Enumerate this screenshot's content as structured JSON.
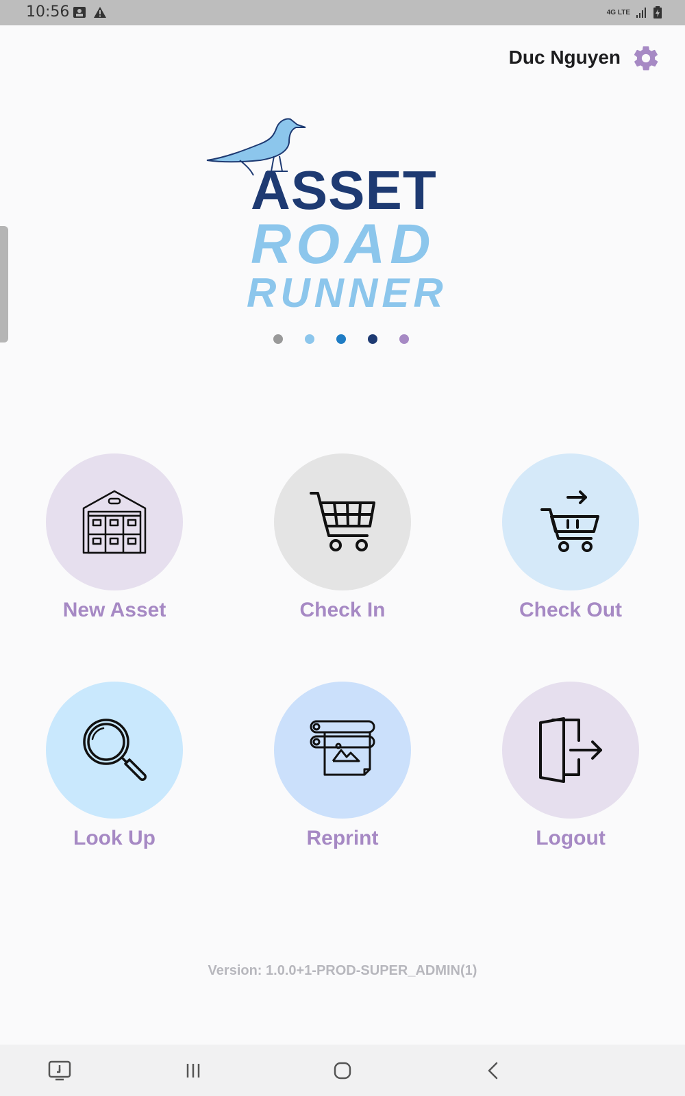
{
  "status": {
    "time": "10:56",
    "network": "4G LTE"
  },
  "header": {
    "user_name": "Duc Nguyen",
    "settings_icon": "gear-icon"
  },
  "logo": {
    "line1": "ASSET",
    "line2": "ROAD",
    "line3": "RUNNER"
  },
  "carousel_dots": [
    "#999999",
    "#8cc6ec",
    "#1f7cc4",
    "#1e3a72",
    "#a689c4"
  ],
  "actions": [
    {
      "label": "New Asset",
      "icon": "warehouse-icon",
      "bg": "#e6dfee"
    },
    {
      "label": "Check In",
      "icon": "cart-icon",
      "bg": "#e4e4e4"
    },
    {
      "label": "Check Out",
      "icon": "cart-arrow-icon",
      "bg": "#d5e9f9"
    },
    {
      "label": "Look Up",
      "icon": "magnifier-icon",
      "bg": "#c9e8fd"
    },
    {
      "label": "Reprint",
      "icon": "printer-icon",
      "bg": "#cbe0fb"
    },
    {
      "label": "Logout",
      "icon": "logout-door-icon",
      "bg": "#e6dfee"
    }
  ],
  "version": "Version: 1.0.0+1-PROD-SUPER_ADMIN(1)",
  "colors": {
    "accent_purple": "#a689c4",
    "navy": "#1e3a72",
    "light_blue": "#8cc6ec"
  }
}
